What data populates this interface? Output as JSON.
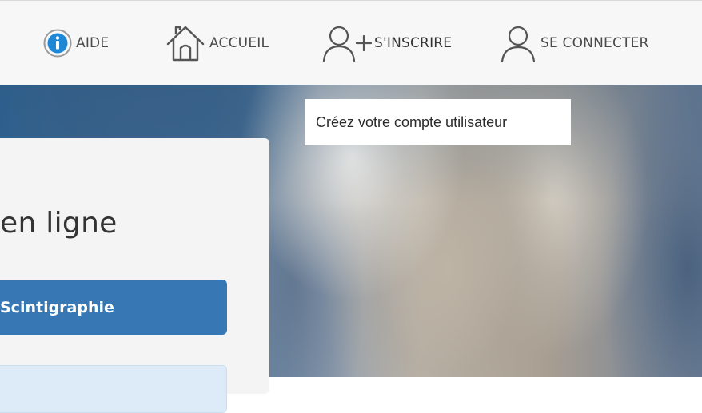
{
  "nav": {
    "items": [
      {
        "id": "aide",
        "label": "AIDE",
        "icon": "info-circle-icon"
      },
      {
        "id": "accueil",
        "label": "ACCUEIL",
        "icon": "home-icon"
      },
      {
        "id": "inscrire",
        "label": "S'INSCRIRE",
        "icon": "user-plus-icon"
      },
      {
        "id": "connecter",
        "label": "SE CONNECTER",
        "icon": "user-icon"
      }
    ]
  },
  "tooltip": {
    "text": "Créez votre compte utilisateur"
  },
  "panel": {
    "title": "en ligne",
    "primary_button_label": "Scintigraphie"
  },
  "colors": {
    "accent": "#1e88d6",
    "button": "#3778b4",
    "text": "#4a4a4a"
  }
}
